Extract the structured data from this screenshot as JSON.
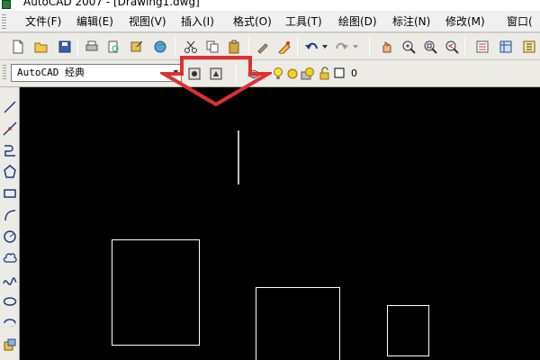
{
  "window": {
    "title": "AutoCAD 2007 - [Drawing1.dwg]"
  },
  "menu": {
    "items": [
      {
        "label": "文件(F)"
      },
      {
        "label": "编辑(E)"
      },
      {
        "label": "视图(V)"
      },
      {
        "label": "插入(I)"
      },
      {
        "label": "格式(O)"
      },
      {
        "label": "工具(T)"
      },
      {
        "label": "绘图(D)"
      },
      {
        "label": "标注(N)"
      },
      {
        "label": "修改(M)"
      },
      {
        "label": "窗口("
      }
    ]
  },
  "workspace": {
    "selected": "AutoCAD 经典"
  },
  "layer": {
    "current": "0"
  },
  "colors": {
    "canvas_bg": "#000000",
    "drawing_lines": "#ffffff",
    "callout_arrow": "#e03030"
  }
}
